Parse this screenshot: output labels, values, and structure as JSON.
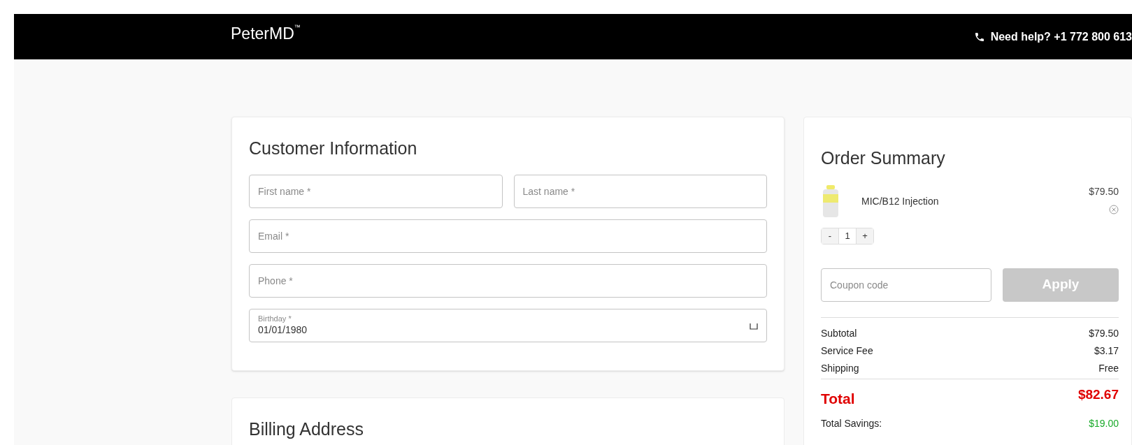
{
  "header": {
    "logo": "PeterMD",
    "trademark": "™",
    "help_text": "Need help? +1 772 800 613"
  },
  "customer_information": {
    "title": "Customer Information",
    "field_rows": [
      [
        {
          "kind": "text",
          "placeholder": "First name *"
        },
        {
          "kind": "text",
          "placeholder": "Last name *"
        }
      ],
      [
        {
          "kind": "text",
          "placeholder": "Email *"
        }
      ],
      [
        {
          "kind": "text",
          "placeholder": "Phone *"
        }
      ],
      [
        {
          "kind": "date",
          "label": "Birthday *",
          "value": "01/01/1980"
        }
      ]
    ]
  },
  "billing_address": {
    "title": "Billing Address"
  },
  "order_summary": {
    "title": "Order Summary",
    "items": [
      {
        "name": "MIC/B12 Injection",
        "price": "$79.50",
        "quantity": "1",
        "decrement": "-",
        "increment": "+"
      }
    ],
    "coupon": {
      "placeholder": "Coupon code",
      "button": "Apply",
      "disabled": true
    },
    "lines": [
      {
        "label": "Subtotal",
        "value": "$79.50"
      },
      {
        "label": "Service Fee",
        "value": "$3.17"
      },
      {
        "label": "Shipping",
        "value": "Free"
      }
    ],
    "total": {
      "label": "Total",
      "value": "$82.67"
    },
    "savings": {
      "label": "Total Savings:",
      "value": "$19.00"
    }
  }
}
